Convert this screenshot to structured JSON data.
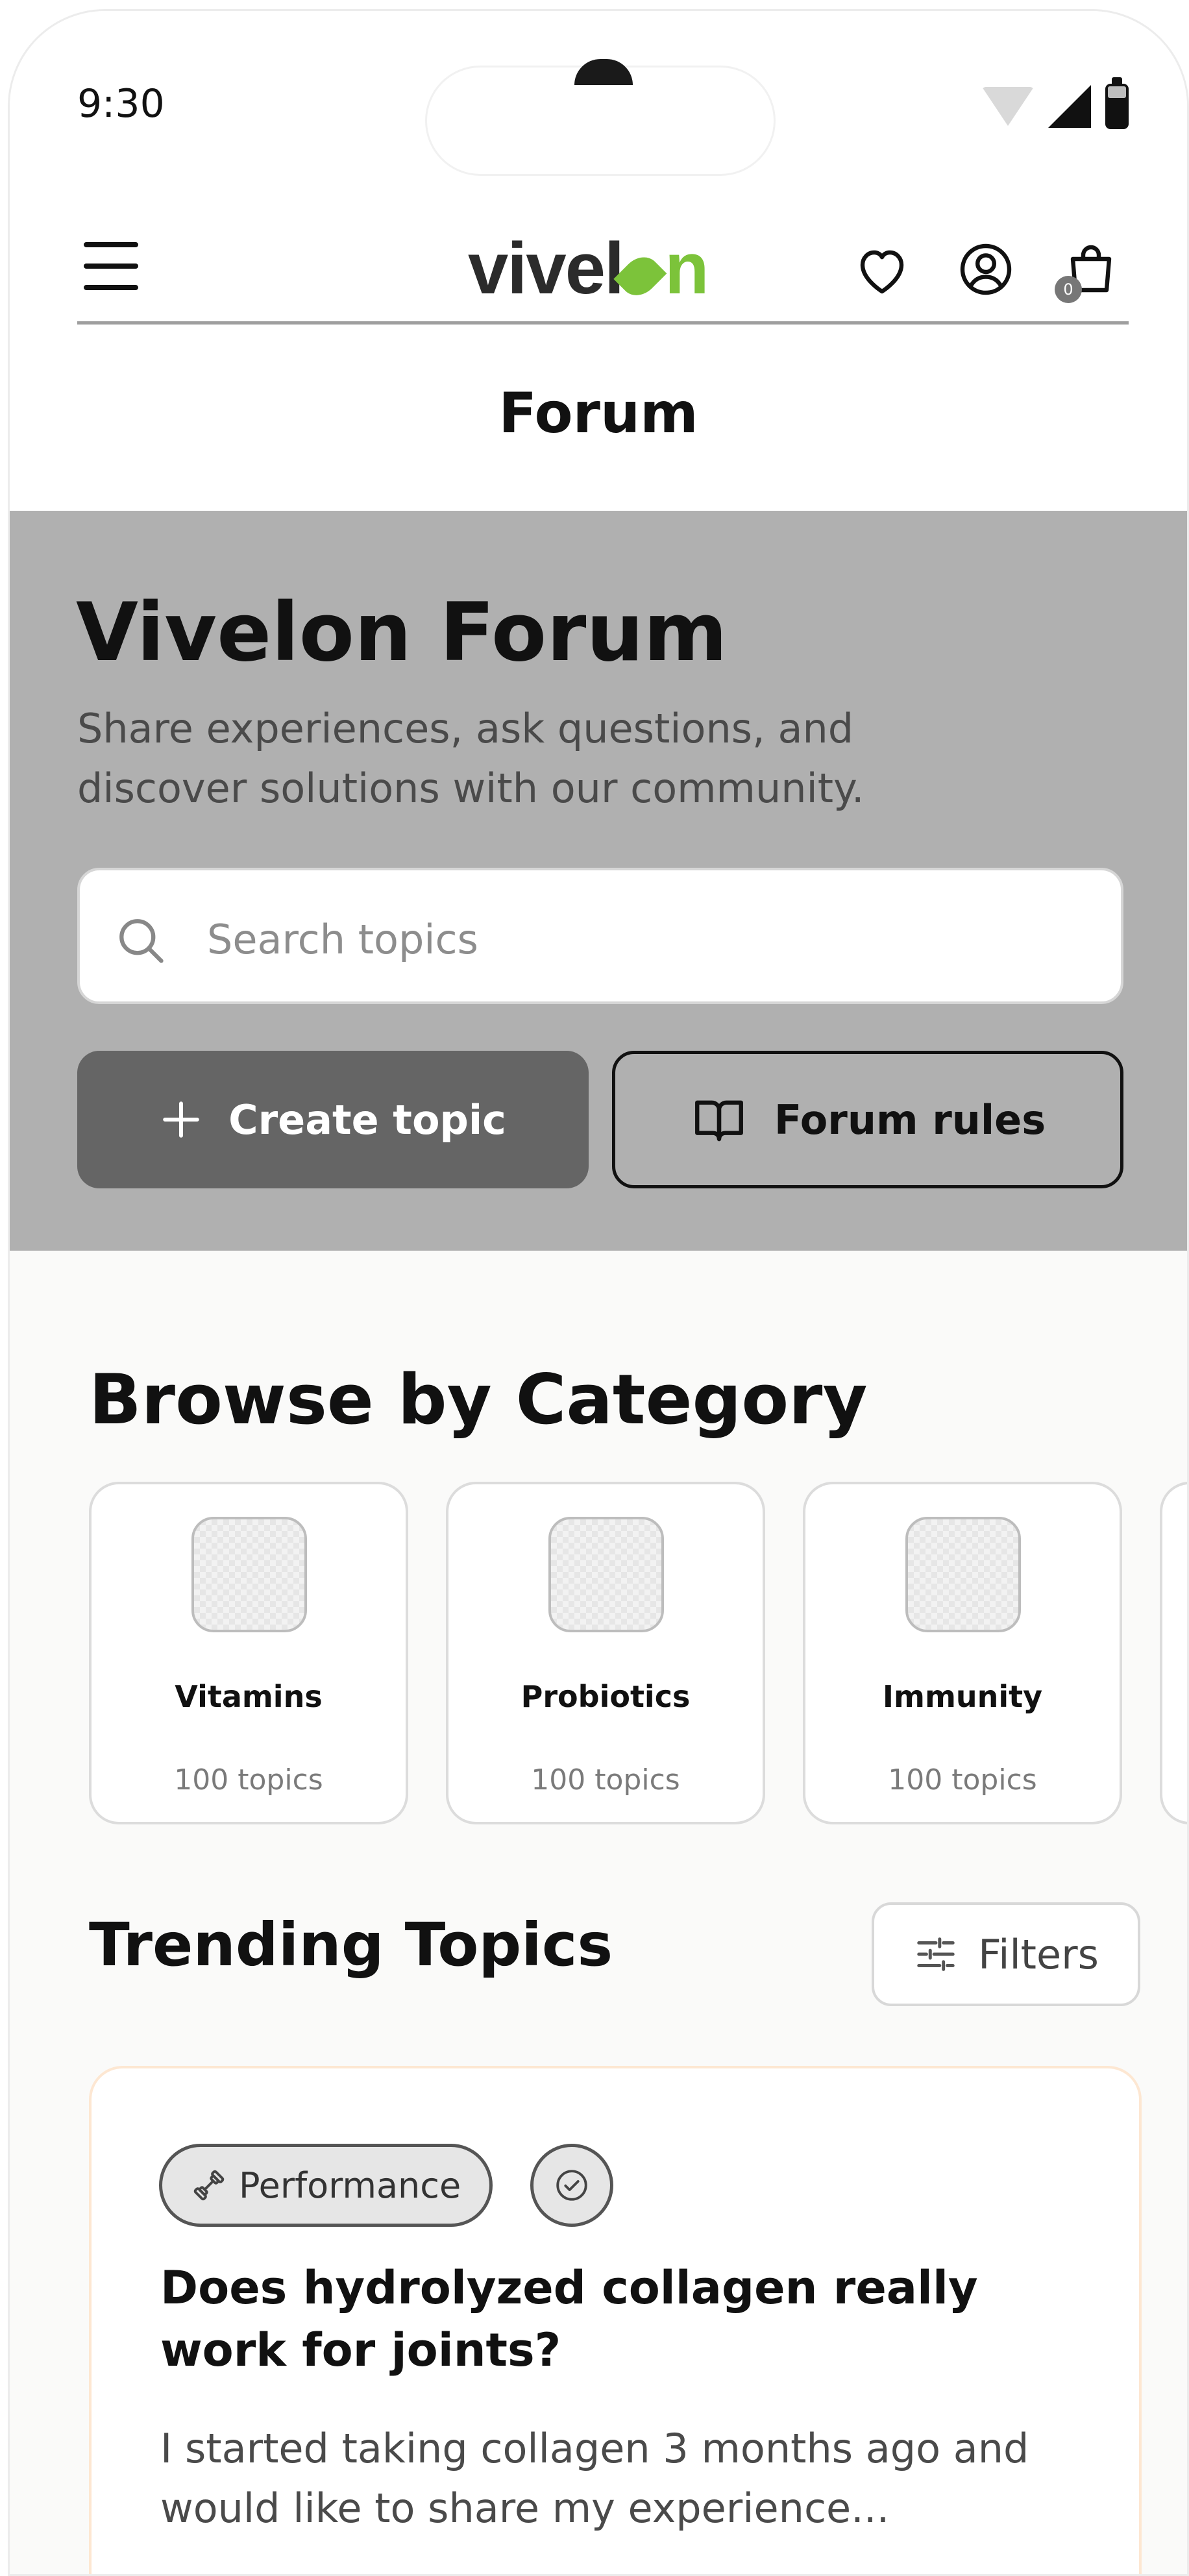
{
  "status_bar": {
    "time": "9:30"
  },
  "header": {
    "logo_prefix": "vivel",
    "logo_suffix": "n",
    "page_title": "Forum",
    "cart_count": "0"
  },
  "hero": {
    "title": "Vivelon Forum",
    "subtitle": "Share experiences, ask questions, and discover solutions with our community.",
    "search_placeholder": "Search topics",
    "create_label": "Create topic",
    "rules_label": "Forum rules"
  },
  "categories": {
    "title": "Browse by Category",
    "items": [
      {
        "name": "Vitamins",
        "count": "100 topics"
      },
      {
        "name": "Probiotics",
        "count": "100 topics"
      },
      {
        "name": "Immunity",
        "count": "100 topics"
      },
      {
        "name": "",
        "count": ""
      }
    ]
  },
  "trending": {
    "title": "Trending Topics",
    "filters_label": "Filters",
    "topics": [
      {
        "tag": "Performance",
        "title": "Does hydrolyzed collagen really work for joints?",
        "excerpt": "I started taking collagen 3 months ago and would like to share my experience..."
      }
    ]
  },
  "colors": {
    "brand_green": "#7cc33a",
    "hero_bg": "#b0b0b0",
    "primary_button": "#656565",
    "card_border_accent": "#fde7d2"
  },
  "icons": [
    "menu-icon",
    "heart-icon",
    "account-icon",
    "cart-icon",
    "search-icon",
    "plus-icon",
    "book-icon",
    "image-placeholder-icon",
    "sliders-icon",
    "dumbbell-icon",
    "check-circle-icon"
  ]
}
